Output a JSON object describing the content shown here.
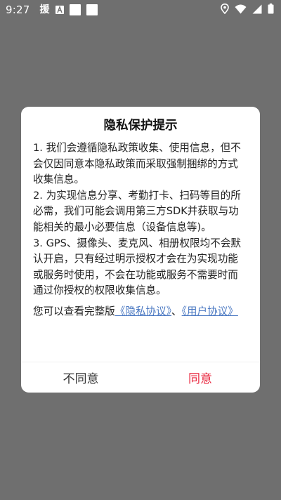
{
  "status_bar": {
    "time": "9:27",
    "notification_text": "援",
    "icons": [
      "text-a-icon",
      "white-square-icon",
      "white-square-icon",
      "location-icon",
      "wifi-icon",
      "signal-icon",
      "battery-icon"
    ]
  },
  "dialog": {
    "title": "隐私保护提示",
    "paragraph1": "1. 我们会遵循隐私政策收集、使用信息，但不会仅因同意本隐私政策而采取强制捆绑的方式收集信息。",
    "paragraph2": "2. 为实现信息分享、考勤打卡、扫码等目的所必需，我们可能会调用第三方SDK并获取与功能相关的最小必要信息（设备信息等)。",
    "paragraph3": "3. GPS、摄像头、麦克风、相册权限均不会默认开启，只有经过明示授权才会在为实现功能或服务时使用，不会在功能或服务不需要时而通过你授权的权限收集信息。",
    "link_prefix": "您可以查看完整版",
    "privacy_link": "《隐私协议》",
    "separator": "、",
    "user_link": "《用户协议》",
    "disagree_label": "不同意",
    "agree_label": "同意"
  },
  "colors": {
    "overlay": "#6f6f6f",
    "link": "#4a78c2",
    "agree": "#e8243c"
  }
}
